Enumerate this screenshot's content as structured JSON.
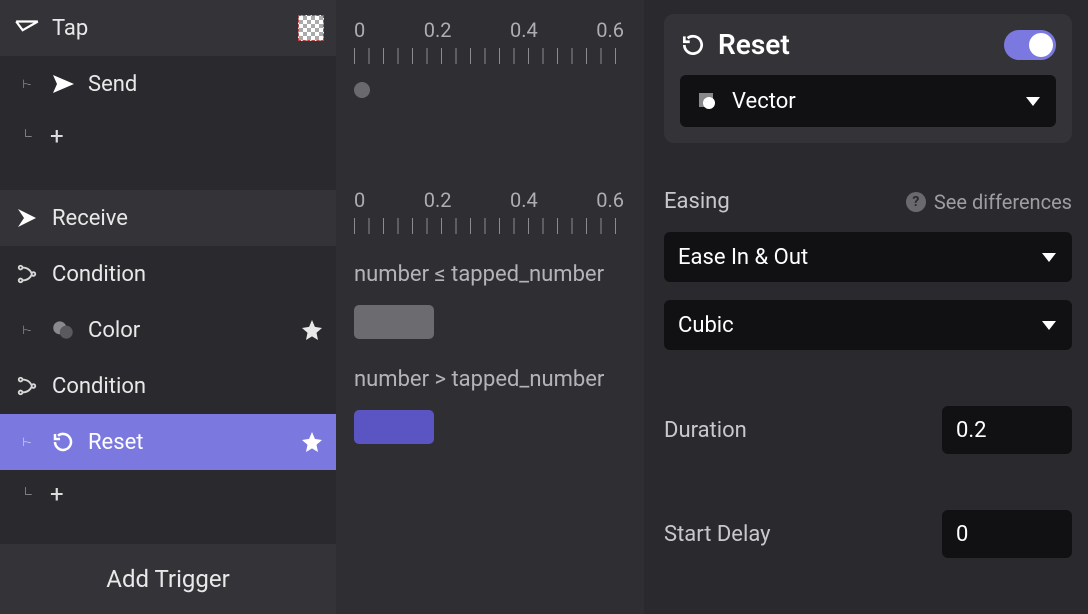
{
  "sidebar": {
    "tap": {
      "label": "Tap"
    },
    "send": {
      "label": "Send"
    },
    "receive": {
      "label": "Receive"
    },
    "condition1": {
      "label": "Condition"
    },
    "color": {
      "label": "Color"
    },
    "condition2": {
      "label": "Condition"
    },
    "reset": {
      "label": "Reset"
    },
    "add_trigger": "Add Trigger"
  },
  "timeline": {
    "ruler1": {
      "ticks": [
        "0",
        "0.2",
        "0.4",
        "0.6"
      ]
    },
    "ruler2": {
      "ticks": [
        "0",
        "0.2",
        "0.4",
        "0.6"
      ]
    },
    "cond1_text": "number ≤ tapped_number",
    "cond2_text": "number > tapped_number"
  },
  "inspector": {
    "card": {
      "title": "Reset",
      "toggle_on": true,
      "dropdown_label": "Vector"
    },
    "easing": {
      "section": "Easing",
      "hint": "See differences",
      "type": "Ease In & Out",
      "curve": "Cubic"
    },
    "duration": {
      "label": "Duration",
      "value": "0.2"
    },
    "start_delay": {
      "label": "Start Delay",
      "value": "0"
    }
  }
}
